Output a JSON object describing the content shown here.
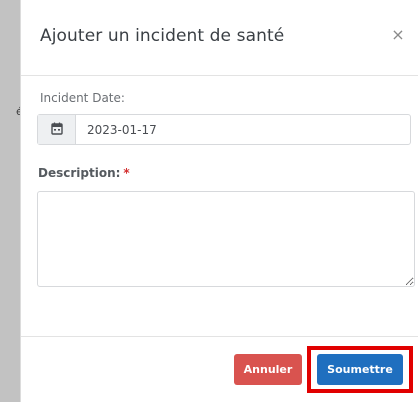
{
  "background": {
    "edge_glyph": "é"
  },
  "dialog": {
    "title": "Ajouter un incident de santé",
    "close_symbol": "×"
  },
  "form": {
    "incident_date": {
      "label": "Incident Date:",
      "value": "2023-01-17",
      "icon": "calendar-icon"
    },
    "description": {
      "label": "Description:",
      "required_marker": "*",
      "value": ""
    }
  },
  "footer": {
    "cancel_label": "Annuler",
    "submit_label": "Soumettre"
  },
  "colors": {
    "cancel": "#d9534f",
    "submit": "#1f6fbf",
    "highlight": "#e10000",
    "required": "#d32f2f"
  }
}
